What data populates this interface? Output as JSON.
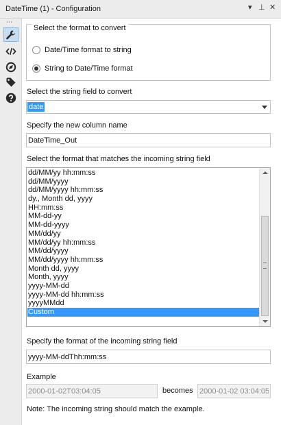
{
  "window": {
    "title": "DateTime (1) - Configuration",
    "menu_glyph": "▾",
    "pin_glyph": "⊥",
    "close_glyph": "✕"
  },
  "sidebar": {
    "grip": "⋯",
    "items": [
      {
        "icon": "wrench-icon",
        "active": true
      },
      {
        "icon": "code-icon",
        "active": false
      },
      {
        "icon": "compass-icon",
        "active": false
      },
      {
        "icon": "tag-icon",
        "active": false
      },
      {
        "icon": "help-icon",
        "active": false
      }
    ]
  },
  "convert": {
    "legend": "Select the format to convert",
    "options": [
      {
        "label": "Date/Time format to string",
        "checked": false
      },
      {
        "label": "String to Date/Time format",
        "checked": true
      }
    ]
  },
  "string_field": {
    "label": "Select the string field to convert",
    "value": "date"
  },
  "new_column": {
    "label": "Specify the new column name",
    "value": "DateTime_Out"
  },
  "format_list": {
    "label": "Select the format that matches the incoming string field",
    "items": [
      "dd/MM/yy hh:mm:ss",
      "dd/MM/yyyy",
      "dd/MM/yyyy hh:mm:ss",
      "dy., Month dd, yyyy",
      "HH:mm:ss",
      "MM-dd-yy",
      "MM-dd-yyyy",
      "MM/dd/yy",
      "MM/dd/yy hh:mm:ss",
      "MM/dd/yyyy",
      "MM/dd/yyyy hh:mm:ss",
      "Month dd, yyyy",
      "Month, yyyy",
      "yyyy-MM-dd",
      "yyyy-MM-dd hh:mm:ss",
      "yyyyMMdd",
      "Custom"
    ],
    "selected": "Custom"
  },
  "custom_format": {
    "label": "Specify the format of the incoming string field",
    "value": "yyyy-MM-ddThh:mm:ss"
  },
  "example": {
    "label": "Example",
    "input": "2000-01-02T03:04:05",
    "becomes": "becomes",
    "output": "2000-01-02 03:04:05",
    "note": "Note: The incoming string should match the example."
  },
  "colors": {
    "selection": "#3399ff",
    "ok_icon": "#3c3c3c",
    "panel_bg": "#ececec"
  }
}
